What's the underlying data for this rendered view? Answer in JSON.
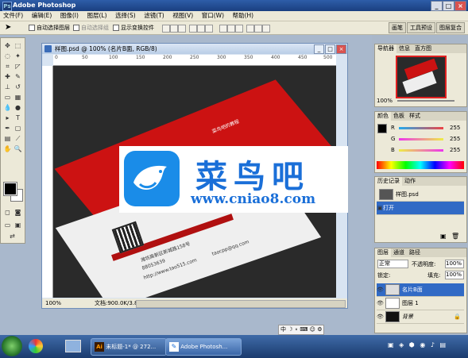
{
  "window": {
    "title": "Adobe Photoshop",
    "min": "_",
    "max": "□",
    "close": "×"
  },
  "menu": [
    "文件(F)",
    "编辑(E)",
    "图像(I)",
    "图层(L)",
    "选择(S)",
    "滤镜(T)",
    "视图(V)",
    "窗口(W)",
    "帮助(H)"
  ],
  "options": {
    "auto_select_layer": "自动选择图层",
    "auto_select_group": "自动选择组",
    "show_transform": "显示变换控件"
  },
  "panel_tabs": [
    "画笔",
    "工具预设",
    "图层复合"
  ],
  "document": {
    "title": "样图.psd @ 100% (名片B面, RGB/8)",
    "zoom": "100%",
    "docinfo": "文档:900.0K/3.87M",
    "ruler": [
      "0",
      "50",
      "100",
      "150",
      "200",
      "250",
      "300",
      "350",
      "400",
      "450",
      "500"
    ]
  },
  "card": {
    "red_text": "菜鸟吧的教程",
    "address": "潍坊高新区新城路158号",
    "phone": "88053639",
    "web": "http://www.tao515.com",
    "email": "taocpp@qq.com"
  },
  "watermark": {
    "title": "菜鸟吧",
    "url": "www.cniao8.com"
  },
  "navigator": {
    "tabs": [
      "导航器",
      "信息",
      "直方图"
    ],
    "zoom": "100%"
  },
  "color": {
    "tabs": [
      "颜色",
      "色板",
      "样式"
    ],
    "channels": [
      {
        "label": "R",
        "value": "255",
        "color": "#e84c4c"
      },
      {
        "label": "G",
        "value": "255",
        "color": "#4ccf4c"
      },
      {
        "label": "B",
        "value": "255",
        "color": "#4c6ce8"
      }
    ]
  },
  "history": {
    "tabs": [
      "历史记录",
      "动作"
    ],
    "doc": "样图.psd",
    "items": [
      "打开"
    ]
  },
  "layers": {
    "tabs": [
      "图层",
      "通道",
      "路径"
    ],
    "blend_mode": "正常",
    "opacity_label": "不透明度:",
    "opacity": "100%",
    "lock_label": "锁定:",
    "fill_label": "填充:",
    "fill": "100%",
    "items": [
      {
        "name": "名片B面",
        "selected": true
      },
      {
        "name": "图层 1",
        "selected": false
      },
      {
        "name": "背景",
        "selected": false
      }
    ]
  },
  "taskbar": {
    "items": [
      "未标题-1* @ 272...",
      "Adobe Photosh..."
    ],
    "ime": "中"
  },
  "colors": {
    "accent": "#1a6fd8",
    "card_red": "#cc1212",
    "selection": "#316ac5"
  }
}
